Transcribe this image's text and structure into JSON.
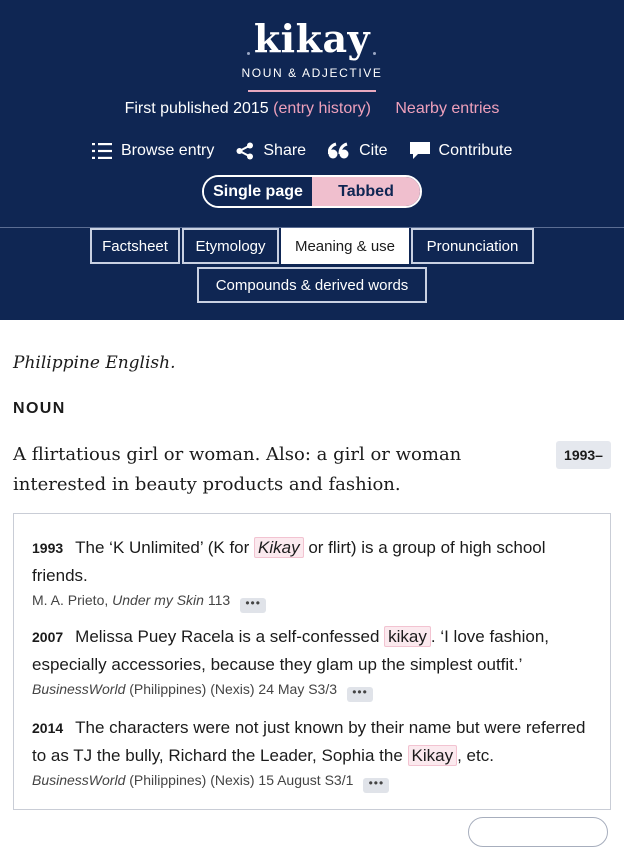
{
  "header": {
    "headword": "kikay",
    "part_of_speech": "NOUN & ADJECTIVE",
    "first_published": "First published 2015",
    "entry_history": "(entry history)",
    "nearby_entries": "Nearby entries",
    "actions": [
      {
        "label": "Browse entry",
        "icon": "list-icon"
      },
      {
        "label": "Share",
        "icon": "share-icon"
      },
      {
        "label": "Cite",
        "icon": "quote-icon"
      },
      {
        "label": "Contribute",
        "icon": "speech-bubble-icon"
      }
    ],
    "view_toggle": {
      "single": "Single page",
      "tabbed": "Tabbed",
      "selected": "Tabbed"
    },
    "tabs": [
      "Factsheet",
      "Etymology",
      "Meaning & use",
      "Pronunciation",
      "Compounds & derived words"
    ],
    "active_tab": "Meaning & use"
  },
  "colors": {
    "header_bg": "#0f2653",
    "accent_pink": "#eea0bb",
    "toggle_active": "#f0bfce"
  },
  "content": {
    "variety": "Philippine English.",
    "pos": "NOUN",
    "definition": "A flirtatious girl or woman. Also: a girl or woman interested in beauty products and fashion.",
    "date_range": "1993–",
    "quotations": [
      {
        "year": "1993",
        "text_before": "The ‘K Unlimited’ (K for ",
        "highlight": "Kikay",
        "text_after": " or flirt) is a group of high school friends.",
        "source_author": "M. A. Prieto, ",
        "source_title": "Under my Skin",
        "source_rest": " 113"
      },
      {
        "year": "2007",
        "text_before": "Melissa Puey Racela is a self-confessed ",
        "highlight": "kikay",
        "text_after": ". ‘I love fashion, especially accessories, because they glam up the simplest outfit.’",
        "source_author": "",
        "source_title": "BusinessWorld",
        "source_rest": " (Philippines) (Nexis) 24 May S3/3"
      },
      {
        "year": "2014",
        "text_before": "The characters were not just known by their name but were referred to as TJ the bully, Richard the Leader, Sophia the ",
        "highlight": "Kikay",
        "text_after": ", etc.",
        "source_author": "",
        "source_title": "BusinessWorld",
        "source_rest": " (Philippines) (Nexis) 15 August S3/1"
      }
    ],
    "more_label": "•••"
  }
}
